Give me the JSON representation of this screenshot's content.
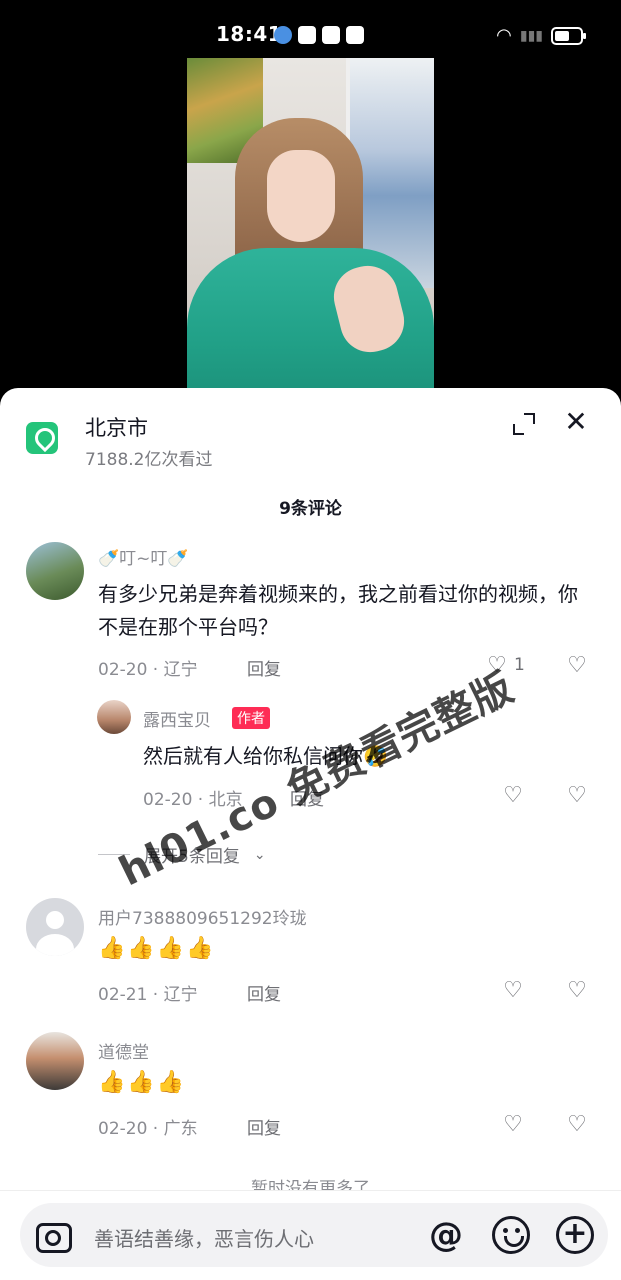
{
  "status_bar": {
    "time": "18:41"
  },
  "location": {
    "title": "北京市",
    "views": "7188.2亿次看过"
  },
  "comments_header": {
    "count_label": "9条评论"
  },
  "comments": [
    {
      "nickname": "🍼叮~叮🍼",
      "text": "有多少兄弟是奔着视频来的，我之前看过你的视频，你不是在那个平台吗？",
      "date": "02-20",
      "region": "辽宁",
      "reply_label": "回复",
      "like_count": "1"
    },
    {
      "nickname": "露西宝贝",
      "author_tag": "作者",
      "text": "然后就有人给你私信问你🤣",
      "date": "02-20",
      "region": "北京",
      "reply_label": "回复"
    },
    {
      "nickname": "用户7388809651292玲珑",
      "text": "👍👍👍👍",
      "date": "02-21",
      "region": "辽宁",
      "reply_label": "回复"
    },
    {
      "nickname": "道德堂",
      "text": "👍👍👍",
      "date": "02-20",
      "region": "广东",
      "reply_label": "回复"
    }
  ],
  "expand_replies": "展开5条回复",
  "end_text": "暂时没有更多了",
  "watermark": "hl01.co 免费看完整版",
  "input": {
    "placeholder": "善语结善缘，恶言伤人心"
  },
  "icons": {
    "location": "location-pin-icon",
    "expand": "expand-icon",
    "close": "close-icon",
    "like": "heart-icon",
    "dislike": "broken-heart-icon",
    "camera": "camera-icon",
    "mention": "at-icon",
    "emoji": "emoji-icon",
    "add": "plus-icon"
  },
  "colors": {
    "location_icon": "#24c47a",
    "author_tag": "#fe2c55"
  }
}
